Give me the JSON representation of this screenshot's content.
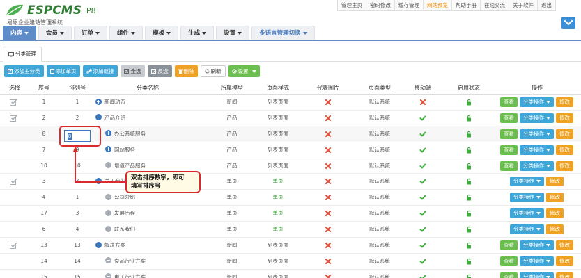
{
  "brand": {
    "name": "ESPCMS",
    "version": "P8",
    "subtitle": "易思企业建站管理系统"
  },
  "top_links": [
    {
      "label": "管理主页",
      "active": false
    },
    {
      "label": "密码修改",
      "active": false
    },
    {
      "label": "缓存管理",
      "active": false
    },
    {
      "label": "网站预览",
      "active": true
    },
    {
      "label": "帮助手册",
      "active": false
    },
    {
      "label": "在线交流",
      "active": false
    },
    {
      "label": "关于软件",
      "active": false
    },
    {
      "label": "退出",
      "active": false
    }
  ],
  "nav": {
    "items": [
      "内容",
      "会员",
      "订单",
      "组件",
      "模板",
      "生成",
      "设置"
    ],
    "lang": "多语言管理切换"
  },
  "tab": {
    "label": "分类管理"
  },
  "toolbar": {
    "add_main": "添加主分类",
    "add_single": "添加单页",
    "add_link": "添加链接",
    "select_all": "全选",
    "invert": "反选",
    "delete": "删除",
    "refresh": "刷新",
    "settings": "设置"
  },
  "columns": [
    "选择",
    "序号",
    "排列号",
    "分类名称",
    "所属模型",
    "页面样式",
    "代表图片",
    "页面类型",
    "移动端",
    "启用状态",
    "操作"
  ],
  "rows": [
    {
      "check": true,
      "id": "1",
      "sort": "1",
      "level": 0,
      "icon": "plus",
      "name": "新闻动态",
      "model": "新闻",
      "style": "列表页面",
      "style_green": false,
      "img": "x",
      "type": "默认系统",
      "mobile": "x",
      "view": true
    },
    {
      "check": true,
      "id": "2",
      "sort": "2",
      "level": 0,
      "icon": "minus",
      "name": "产品介绍",
      "model": "产品",
      "style": "列表页面",
      "style_green": false,
      "img": "x",
      "type": "默认系统",
      "mobile": "check",
      "view": true
    },
    {
      "check": false,
      "id": "8",
      "sort": "",
      "level": 1,
      "icon": "plus",
      "name": "办公系统服务",
      "model": "产品",
      "style": "列表页面",
      "style_green": false,
      "img": "x",
      "type": "默认系统",
      "mobile": "check",
      "view": true
    },
    {
      "check": false,
      "id": "7",
      "sort": "9",
      "level": 1,
      "icon": "plus",
      "name": "网站服务",
      "model": "产品",
      "style": "列表页面",
      "style_green": false,
      "img": "x",
      "type": "默认系统",
      "mobile": "check",
      "view": true
    },
    {
      "check": false,
      "id": "10",
      "sort": "10",
      "level": 1,
      "icon": "leaf",
      "name": "增值产品服务",
      "model": "产品",
      "style": "列表页面",
      "style_green": false,
      "img": "x",
      "type": "默认系统",
      "mobile": "check",
      "view": true
    },
    {
      "check": true,
      "id": "3",
      "sort": "3",
      "level": 0,
      "icon": "minus",
      "name": "关于我们",
      "model": "单页",
      "style": "单页",
      "style_green": true,
      "img": "x",
      "type": "默认系统",
      "mobile": "check",
      "view": false
    },
    {
      "check": false,
      "id": "4",
      "sort": "1",
      "level": 1,
      "icon": "leaf",
      "name": "公司介绍",
      "model": "单页",
      "style": "单页",
      "style_green": true,
      "img": "x",
      "type": "默认系统",
      "mobile": "check",
      "view": false
    },
    {
      "check": false,
      "id": "17",
      "sort": "3",
      "level": 1,
      "icon": "leaf",
      "name": "发展历程",
      "model": "单页",
      "style": "单页",
      "style_green": true,
      "img": "x",
      "type": "默认系统",
      "mobile": "check",
      "view": false
    },
    {
      "check": false,
      "id": "6",
      "sort": "4",
      "level": 1,
      "icon": "leaf",
      "name": "联系我们",
      "model": "单页",
      "style": "单页",
      "style_green": true,
      "img": "x",
      "type": "默认系统",
      "mobile": "check",
      "view": false
    },
    {
      "check": true,
      "id": "13",
      "sort": "13",
      "level": 0,
      "icon": "minus",
      "name": "解决方案",
      "model": "新闻",
      "style": "列表页面",
      "style_green": false,
      "img": "x",
      "type": "默认系统",
      "mobile": "check",
      "view": true
    },
    {
      "check": false,
      "id": "14",
      "sort": "14",
      "level": 1,
      "icon": "leaf",
      "name": "食品行业方案",
      "model": "新闻",
      "style": "列表页面",
      "style_green": false,
      "img": "x",
      "type": "默认系统",
      "mobile": "check",
      "view": true
    },
    {
      "check": false,
      "id": "15",
      "sort": "15",
      "level": 1,
      "icon": "leaf",
      "name": "电子行业方案",
      "model": "新闻",
      "style": "列表页面",
      "style_green": false,
      "img": "x",
      "type": "默认系统",
      "mobile": "check",
      "view": true
    }
  ],
  "ops": {
    "view": "查看",
    "category_ops": "分类操作",
    "edit": "修改"
  },
  "annotation": {
    "input_value": "8",
    "callout_line1": "双击排序数字，即可",
    "callout_line2": "填写排序号"
  },
  "colors": {
    "nav_active": "#5d8cc9",
    "btn_blue": "#3ea6d8",
    "btn_green": "#6bbf4e",
    "btn_orange": "#f0a224",
    "check_green": "#3fae3f",
    "x_red": "#e0503a",
    "annotation_red": "#d92b2b"
  }
}
